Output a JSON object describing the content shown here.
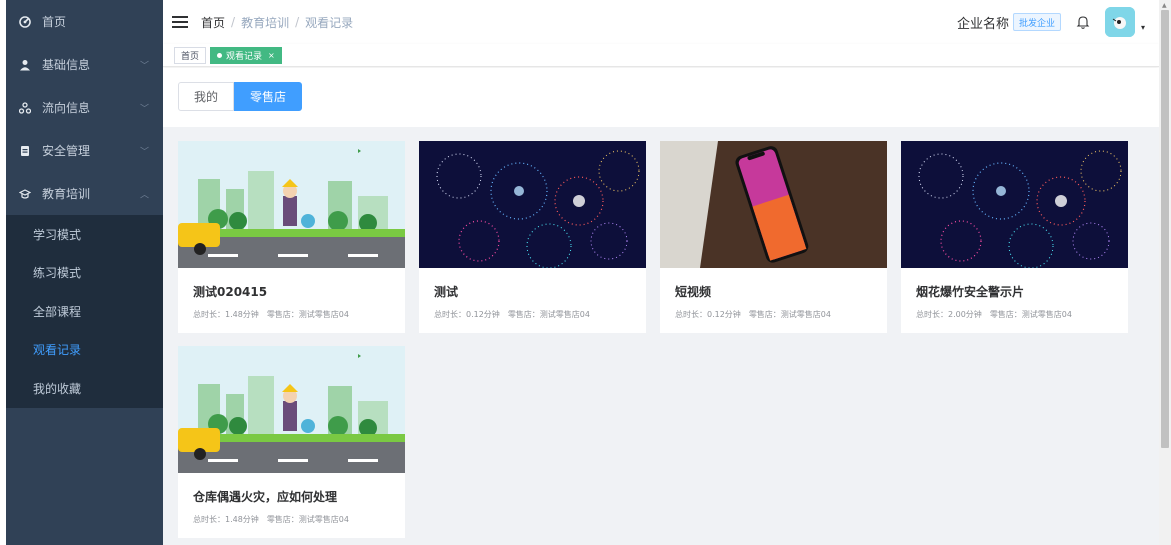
{
  "sidebar": {
    "items": [
      {
        "label": "首页",
        "icon": "dashboard-icon"
      },
      {
        "label": "基础信息",
        "icon": "user-icon"
      },
      {
        "label": "流向信息",
        "icon": "cluster-icon"
      },
      {
        "label": "安全管理",
        "icon": "document-icon"
      },
      {
        "label": "教育培训",
        "icon": "education-icon"
      }
    ],
    "submenu": [
      {
        "label": "学习模式"
      },
      {
        "label": "练习模式"
      },
      {
        "label": "全部课程"
      },
      {
        "label": "观看记录"
      },
      {
        "label": "我的收藏"
      }
    ],
    "active_color": "#409eff"
  },
  "header": {
    "breadcrumb": [
      "首页",
      "教育培训",
      "观看记录"
    ],
    "company_name": "企业名称",
    "company_tag": "批发企业"
  },
  "tags": {
    "home": "首页",
    "active": "观看记录",
    "close": "×"
  },
  "toggle": {
    "options": [
      "我的",
      "零售店"
    ],
    "selected": "零售店"
  },
  "cards": [
    {
      "title": "测试020415",
      "duration": "总时长：1.48分钟",
      "store": "零售店：测试零售店04",
      "image": "cartoon-street-cleaner"
    },
    {
      "title": "测试",
      "duration": "总时长：0.12分钟",
      "store": "零售店：测试零售店04",
      "image": "fireworks"
    },
    {
      "title": "短视频",
      "duration": "总时长：0.12分钟",
      "store": "零售店：测试零售店04",
      "image": "smartphone"
    },
    {
      "title": "烟花爆竹安全警示片",
      "duration": "总时长：2.00分钟",
      "store": "零售店：测试零售店04",
      "image": "fireworks"
    },
    {
      "title": "仓库偶遇火灾，应如何处理",
      "duration": "总时长：1.48分钟",
      "store": "零售店：测试零售店04",
      "image": "cartoon-street-cleaner"
    }
  ]
}
